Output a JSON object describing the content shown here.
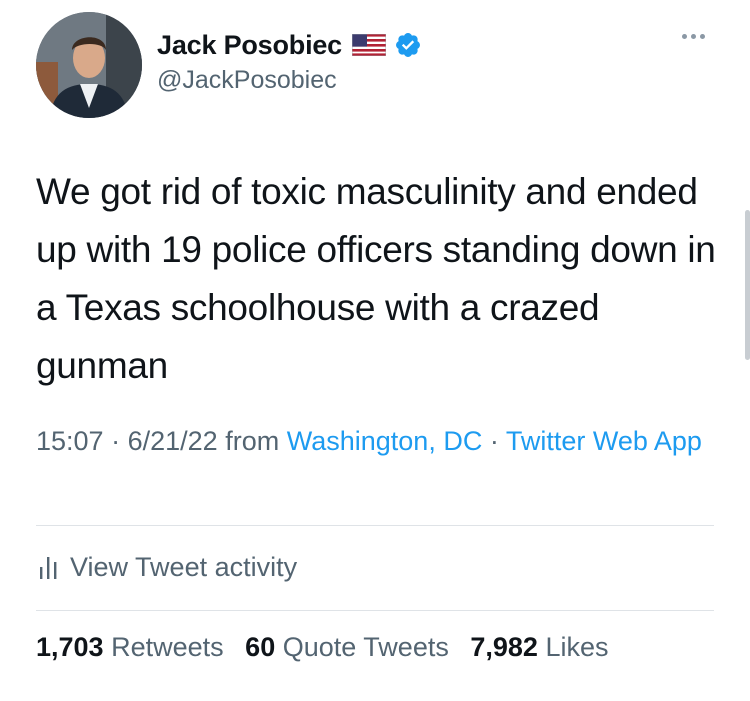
{
  "user": {
    "display_name": "Jack Posobiec",
    "handle": "@JackPosobiec",
    "avatar_icon": "profile-photo",
    "flag_icon": "us-flag-icon",
    "verified_icon": "verified-badge-icon",
    "verified_color": "#1d9bf0"
  },
  "more_icon": "more-options-icon",
  "tweet": {
    "text": "We got rid of toxic masculinity and ended up with 19 police officers standing down in a Texas schoolhouse with a crazed gunman",
    "time": "15:07",
    "separator": "·",
    "date": "6/21/22",
    "from_label": "from",
    "location": "Washington, DC",
    "source": "Twitter Web App"
  },
  "activity": {
    "icon": "bar-chart-icon",
    "label": "View Tweet activity"
  },
  "stats": {
    "retweets_count": "1,703",
    "retweets_label": "Retweets",
    "quotes_count": "60",
    "quotes_label": "Quote Tweets",
    "likes_count": "7,982",
    "likes_label": "Likes"
  },
  "colors": {
    "text": "#0f1419",
    "secondary": "#536471",
    "link": "#1d9bf0",
    "divider": "#dfe3e7"
  }
}
